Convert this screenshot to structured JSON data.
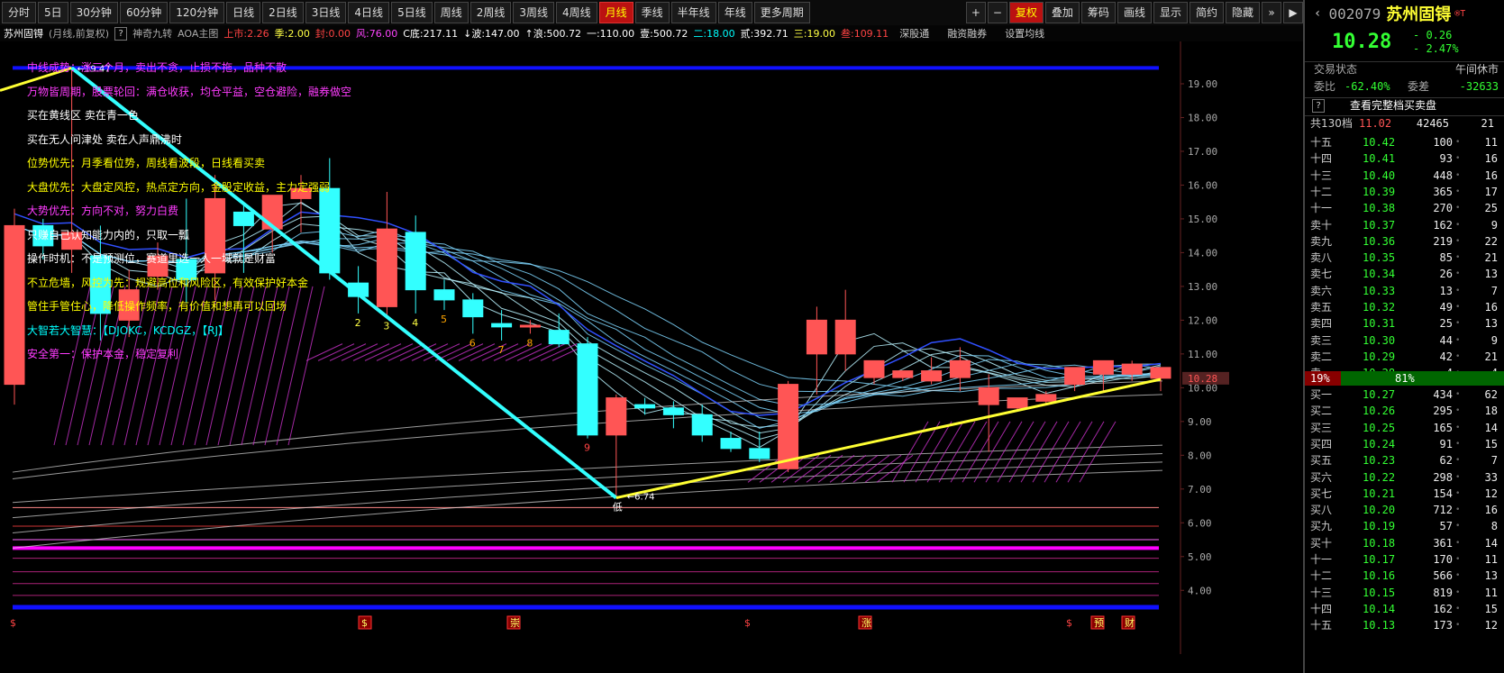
{
  "toolbar": {
    "periods": [
      "分时",
      "5日",
      "30分钟",
      "60分钟",
      "120分钟",
      "日线",
      "2日线",
      "3日线",
      "4日线",
      "5日线",
      "周线",
      "2周线",
      "3周线",
      "4周线",
      "月线",
      "季线",
      "半年线",
      "年线",
      "更多周期"
    ],
    "active_period": "月线",
    "right_buttons": [
      "复权",
      "叠加",
      "筹码",
      "画线",
      "显示",
      "简约",
      "隐藏"
    ],
    "plus": "+",
    "minus": "−",
    "expand": "»",
    "collapse": "▶"
  },
  "infobar": {
    "stock_name": "苏州固锝",
    "mode": "(月线,前复权)",
    "help": "?",
    "indicator": "神奇九转",
    "indicator2": "AOA主图",
    "values": [
      {
        "label": "上市:2.26",
        "color": "#ff4444"
      },
      {
        "label": "季:2.00",
        "color": "#ffff44"
      },
      {
        "label": "封:0.00",
        "color": "#ff4444"
      },
      {
        "label": "风:76.00",
        "color": "#ff44ff"
      },
      {
        "label": "C底:217.11",
        "color": "#ffffff"
      },
      {
        "label": "↓波:147.00",
        "color": "#ffffff"
      },
      {
        "label": "↑浪:500.72",
        "color": "#ffffff"
      },
      {
        "label": "一:110.00",
        "color": "#ffffff"
      },
      {
        "label": "壹:500.72",
        "color": "#ffffff"
      },
      {
        "label": "二:18.00",
        "color": "#00ffff"
      },
      {
        "label": "贰:392.71",
        "color": "#ffffff"
      },
      {
        "label": "三:19.00",
        "color": "#ffff44"
      },
      {
        "label": "叁:109.11",
        "color": "#ff4444"
      }
    ],
    "links": [
      "深股通",
      "融资融券",
      "设置均线"
    ]
  },
  "chart_data": {
    "type": "candlestick",
    "period": "monthly",
    "ylim": [
      3.5,
      19.8
    ],
    "yticks": [
      "19.00",
      "18.00",
      "17.00",
      "16.00",
      "15.00",
      "14.00",
      "13.00",
      "12.00",
      "11.00",
      "10.00",
      "9.00",
      "8.00",
      "7.00",
      "6.00",
      "5.00",
      "4.00"
    ],
    "current_price_label": "10.28",
    "high_label": "19.47",
    "low_label": "6.74",
    "low_marker": "低",
    "candles": [
      {
        "o": 10.1,
        "h": 15.3,
        "l": 9.5,
        "c": 14.8
      },
      {
        "o": 14.8,
        "h": 15.0,
        "l": 13.8,
        "c": 14.2
      },
      {
        "o": 14.1,
        "h": 19.47,
        "l": 13.4,
        "c": 14.6
      },
      {
        "o": 13.9,
        "h": 14.8,
        "l": 11.4,
        "c": 12.2
      },
      {
        "o": 12.0,
        "h": 13.5,
        "l": 11.5,
        "c": 12.9
      },
      {
        "o": 13.3,
        "h": 14.3,
        "l": 12.9,
        "c": 13.9
      },
      {
        "o": 13.8,
        "h": 15.6,
        "l": 12.5,
        "c": 13.2
      },
      {
        "o": 13.4,
        "h": 16.3,
        "l": 12.6,
        "c": 15.6
      },
      {
        "o": 15.2,
        "h": 15.4,
        "l": 13.4,
        "c": 14.8
      },
      {
        "o": 14.7,
        "h": 15.4,
        "l": 14.0,
        "c": 15.7
      },
      {
        "o": 15.6,
        "h": 16.3,
        "l": 14.6,
        "c": 15.9
      },
      {
        "o": 15.9,
        "h": 16.8,
        "l": 13.2,
        "c": 13.4
      },
      {
        "o": 13.1,
        "h": 13.6,
        "l": 12.2,
        "c": 12.7
      },
      {
        "o": 12.4,
        "h": 15.8,
        "l": 12.1,
        "c": 14.7
      },
      {
        "o": 14.6,
        "h": 15.1,
        "l": 12.2,
        "c": 12.9
      },
      {
        "o": 12.9,
        "h": 13.2,
        "l": 12.3,
        "c": 12.6
      },
      {
        "o": 12.6,
        "h": 12.8,
        "l": 11.6,
        "c": 12.1
      },
      {
        "o": 11.9,
        "h": 12.3,
        "l": 11.4,
        "c": 11.8
      },
      {
        "o": 11.8,
        "h": 12.0,
        "l": 11.6,
        "c": 11.85
      },
      {
        "o": 11.7,
        "h": 12.2,
        "l": 11.2,
        "c": 11.3
      },
      {
        "o": 11.3,
        "h": 11.5,
        "l": 8.5,
        "c": 8.6
      },
      {
        "o": 8.6,
        "h": 9.8,
        "l": 6.74,
        "c": 9.7
      },
      {
        "o": 9.5,
        "h": 9.7,
        "l": 9.2,
        "c": 9.4
      },
      {
        "o": 9.4,
        "h": 9.6,
        "l": 8.8,
        "c": 9.2
      },
      {
        "o": 9.2,
        "h": 9.5,
        "l": 8.4,
        "c": 8.6
      },
      {
        "o": 8.5,
        "h": 8.7,
        "l": 8.1,
        "c": 8.2
      },
      {
        "o": 8.2,
        "h": 8.7,
        "l": 7.8,
        "c": 7.9
      },
      {
        "o": 7.6,
        "h": 10.2,
        "l": 7.5,
        "c": 10.1
      },
      {
        "o": 11.0,
        "h": 12.4,
        "l": 9.8,
        "c": 12.0
      },
      {
        "o": 11.0,
        "h": 12.9,
        "l": 10.5,
        "c": 12.0
      },
      {
        "o": 10.3,
        "h": 10.8,
        "l": 10.1,
        "c": 10.8
      },
      {
        "o": 10.3,
        "h": 10.5,
        "l": 10.2,
        "c": 10.5
      },
      {
        "o": 10.2,
        "h": 10.9,
        "l": 10.1,
        "c": 10.5
      },
      {
        "o": 10.3,
        "h": 11.2,
        "l": 9.9,
        "c": 10.8
      },
      {
        "o": 9.5,
        "h": 10.4,
        "l": 8.1,
        "c": 10.0
      },
      {
        "o": 9.4,
        "h": 9.7,
        "l": 9.3,
        "c": 9.7
      },
      {
        "o": 9.6,
        "h": 9.9,
        "l": 9.5,
        "c": 9.8
      },
      {
        "o": 10.1,
        "h": 10.5,
        "l": 9.9,
        "c": 10.6
      },
      {
        "o": 10.4,
        "h": 10.7,
        "l": 9.9,
        "c": 10.8
      },
      {
        "o": 10.4,
        "h": 10.8,
        "l": 10.2,
        "c": 10.7
      },
      {
        "o": 10.28,
        "h": 10.5,
        "l": 9.9,
        "c": 10.6
      }
    ],
    "nine_counts": [
      {
        "i": 12,
        "n": "2",
        "color": "#ff4"
      },
      {
        "i": 13,
        "n": "3",
        "color": "#ff4"
      },
      {
        "i": 14,
        "n": "4",
        "color": "#ff4"
      },
      {
        "i": 15,
        "n": "5",
        "color": "#ffa500"
      },
      {
        "i": 16,
        "n": "6",
        "color": "#ffa500"
      },
      {
        "i": 17,
        "n": "7",
        "color": "#ffa500"
      },
      {
        "i": 18,
        "n": "8",
        "color": "#ffa500"
      },
      {
        "i": 20,
        "n": "9",
        "color": "#f44"
      }
    ],
    "annotations": [
      {
        "text": "中线成势：涨三个月，卖出不贪，止损不拖，品种不散",
        "color": "mag"
      },
      {
        "text": "万物皆周期，股票轮回：满仓收获，均仓平益，空仓避险，融券做空",
        "color": "mag"
      },
      {
        "text": "买在黄线区        卖在青一色",
        "color": "whi"
      },
      {
        "text": "买在无人问津处        卖在人声鼎沸时",
        "color": "whi"
      },
      {
        "text": "位势优先：月季看位势，周线看波段，日线看买卖",
        "color": "yel"
      },
      {
        "text": "大盘优先：大盘定风控，热点定方向，金股定收益，主力定强弱",
        "color": "yel"
      },
      {
        "text": "大势优先：方向不对，努力白费",
        "color": "mag"
      },
      {
        "text": "只赚自己认知能力内的，只取一瓢",
        "color": "whi"
      },
      {
        "text": "操作时机：不是预测位，赛道里选一人一域就是财富",
        "color": "whi"
      },
      {
        "text": "不立危墙，风控为先：规避高位和风险区，有效保护好本金",
        "color": "yel"
      },
      {
        "text": "管住手管住心，降低操作频率，有价值和想再可以回场",
        "color": "yel"
      },
      {
        "text": "大智若大智慧：【DJOKC，KCDGZ，【RJ】",
        "color": "cya"
      },
      {
        "text": "安全第一：保护本金，稳定复利",
        "color": "mag"
      }
    ],
    "bottom_markers": [
      {
        "x": 15,
        "t": "$",
        "box": false
      },
      {
        "x": 405,
        "t": "$",
        "box": true
      },
      {
        "x": 570,
        "t": "崇",
        "box": true
      },
      {
        "x": 830,
        "t": "$",
        "box": false
      },
      {
        "x": 960,
        "t": "涨",
        "box": true
      },
      {
        "x": 1187,
        "t": "$",
        "box": false
      },
      {
        "x": 1218,
        "t": "预",
        "box": true
      },
      {
        "x": 1252,
        "t": "财",
        "box": true
      }
    ]
  },
  "panel": {
    "code": "002079",
    "name": "苏州固锝",
    "badge": "®T",
    "price": "10.28",
    "change": "- 0.26",
    "change_pct": "- 2.47%",
    "status_label": "交易状态",
    "status_value": "午间休市",
    "weibi_label": "委比",
    "weibi_value": "-62.40%",
    "weicha_label": "委差",
    "weicha_value": "-32633",
    "help": "?",
    "full_book_label": "查看完整档买卖盘",
    "total_label": "共130档",
    "total_price": "11.02",
    "total_vol": "42465",
    "total_cnt": "21",
    "ratio_sell": "19%",
    "ratio_buy": "81%",
    "asks": [
      {
        "l": "十五",
        "p": "10.42",
        "v": "100",
        "c": "11"
      },
      {
        "l": "十四",
        "p": "10.41",
        "v": "93",
        "c": "16"
      },
      {
        "l": "十三",
        "p": "10.40",
        "v": "448",
        "c": "16"
      },
      {
        "l": "十二",
        "p": "10.39",
        "v": "365",
        "c": "17"
      },
      {
        "l": "十一",
        "p": "10.38",
        "v": "270",
        "c": "25"
      },
      {
        "l": "卖十",
        "p": "10.37",
        "v": "162",
        "c": "9"
      },
      {
        "l": "卖九",
        "p": "10.36",
        "v": "219",
        "c": "22"
      },
      {
        "l": "卖八",
        "p": "10.35",
        "v": "85",
        "c": "21"
      },
      {
        "l": "卖七",
        "p": "10.34",
        "v": "26",
        "c": "13"
      },
      {
        "l": "卖六",
        "p": "10.33",
        "v": "13",
        "c": "7"
      },
      {
        "l": "卖五",
        "p": "10.32",
        "v": "49",
        "c": "16"
      },
      {
        "l": "卖四",
        "p": "10.31",
        "v": "25",
        "c": "13"
      },
      {
        "l": "卖三",
        "p": "10.30",
        "v": "44",
        "c": "9"
      },
      {
        "l": "卖二",
        "p": "10.29",
        "v": "42",
        "c": "21"
      },
      {
        "l": "卖一",
        "p": "10.28",
        "v": "4",
        "c": "4"
      }
    ],
    "bids": [
      {
        "l": "买一",
        "p": "10.27",
        "v": "434",
        "c": "62"
      },
      {
        "l": "买二",
        "p": "10.26",
        "v": "295",
        "c": "18"
      },
      {
        "l": "买三",
        "p": "10.25",
        "v": "165",
        "c": "14"
      },
      {
        "l": "买四",
        "p": "10.24",
        "v": "91",
        "c": "15"
      },
      {
        "l": "买五",
        "p": "10.23",
        "v": "62",
        "c": "7"
      },
      {
        "l": "买六",
        "p": "10.22",
        "v": "298",
        "c": "33"
      },
      {
        "l": "买七",
        "p": "10.21",
        "v": "154",
        "c": "12"
      },
      {
        "l": "买八",
        "p": "10.20",
        "v": "712",
        "c": "16"
      },
      {
        "l": "买九",
        "p": "10.19",
        "v": "57",
        "c": "8"
      },
      {
        "l": "买十",
        "p": "10.18",
        "v": "361",
        "c": "14"
      },
      {
        "l": "十一",
        "p": "10.17",
        "v": "170",
        "c": "11"
      },
      {
        "l": "十二",
        "p": "10.16",
        "v": "566",
        "c": "13"
      },
      {
        "l": "十三",
        "p": "10.15",
        "v": "819",
        "c": "11"
      },
      {
        "l": "十四",
        "p": "10.14",
        "v": "162",
        "c": "15"
      },
      {
        "l": "十五",
        "p": "10.13",
        "v": "173",
        "c": "12"
      }
    ],
    "colors": {
      "up": "#ff5555",
      "down": "#33ff33",
      "cyan": "#00ffff"
    }
  }
}
